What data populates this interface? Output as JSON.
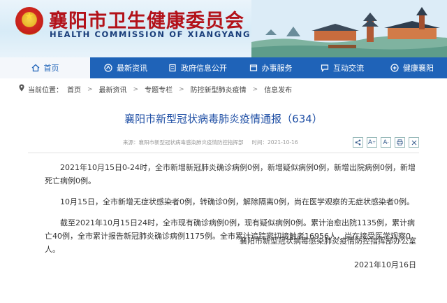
{
  "header": {
    "title": "襄阳市卫生健康委员会",
    "subtitle": "HEALTH COMMISSION OF XIANGYANG"
  },
  "nav": {
    "items": [
      {
        "label": "首页",
        "icon": "home-icon"
      },
      {
        "label": "最新资讯",
        "icon": "news-icon"
      },
      {
        "label": "政府信息公开",
        "icon": "document-icon"
      },
      {
        "label": "办事服务",
        "icon": "service-icon"
      },
      {
        "label": "互动交流",
        "icon": "chat-icon"
      },
      {
        "label": "健康襄阳",
        "icon": "health-icon"
      }
    ]
  },
  "breadcrumb": {
    "prefix": "当前位置：",
    "items": [
      "首页",
      "最新资讯",
      "专题专栏",
      "防控新型肺炎疫情",
      "信息发布"
    ]
  },
  "article": {
    "title": "襄阳市新型冠状病毒肺炎疫情通报（634）",
    "source": "来源：襄阳市新型冠状病毒感染肺炎疫情防控指挥部",
    "date_label": "时间：2021-10-16",
    "paragraphs": [
      "2021年10月15日0-24时，全市新增新冠肺炎确诊病例0例，新增疑似病例0例，新增出院病例0例，新增死亡病例0例。",
      "10月15日，全市新增无症状感染者0例，转确诊0例，解除隔离0例，尚在医学观察的无症状感染者0例。",
      "截至2021年10月15日24时，全市现有确诊病例0例，现有疑似病例0例。累计治愈出院1135例，累计病亡40例，全市累计报告新冠肺炎确诊病例1175例。全市累计追踪密切接触者16956人，尚在接受医学观察0人。"
    ],
    "signature": "襄阳市新型冠状病毒感染肺炎疫情防控指挥部办公室",
    "date": "2021年10月16日"
  },
  "tools": {
    "share_icon": "share-icon",
    "font_larger": "A",
    "font_smaller": "A",
    "print_icon": "print-icon",
    "close_icon": "close-icon"
  },
  "colors": {
    "nav": "#1f63b8",
    "brand_red": "#b3121a",
    "article_title": "#1f4fa5"
  }
}
